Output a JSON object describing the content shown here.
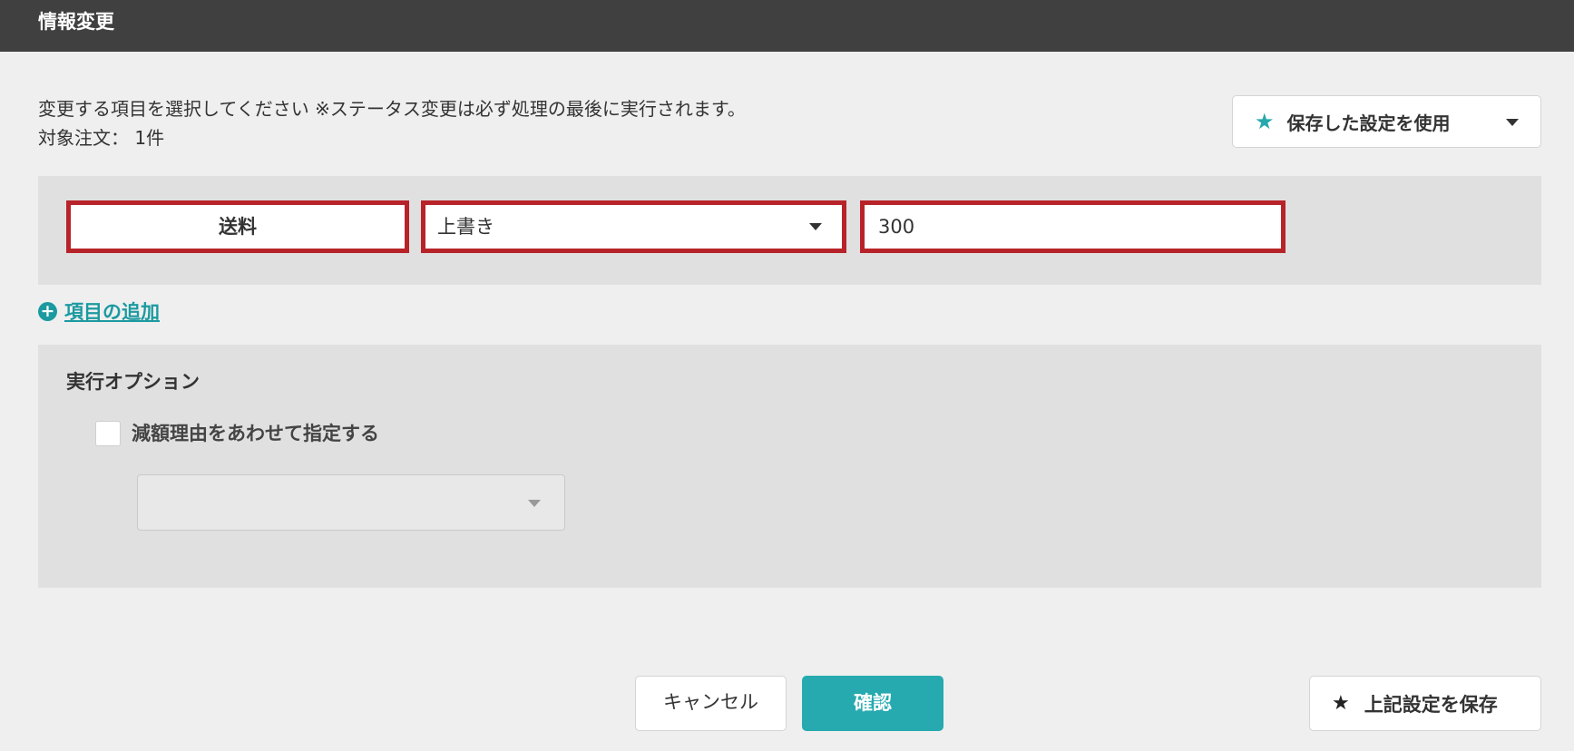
{
  "window": {
    "title": "情報変更"
  },
  "description": {
    "instruction": "変更する項目を選択してください ※ステータス変更は必ず処理の最後に実行されます。",
    "target_orders": "対象注文： 1件"
  },
  "saved_settings": {
    "label": "保存した設定を使用",
    "icon": "star-icon"
  },
  "edit_row": {
    "field_name": "送料",
    "operation": "上書き",
    "value": "300"
  },
  "add_item": {
    "label": "項目の追加",
    "icon": "plus-circle-icon"
  },
  "options": {
    "title": "実行オプション",
    "reduction_reason_label": "減額理由をあわせて指定する",
    "reduction_reason_checked": false,
    "reduction_reason_value": ""
  },
  "footer": {
    "cancel_label": "キャンセル",
    "confirm_label": "確認",
    "save_settings_label": "上記設定を保存"
  },
  "colors": {
    "accent": "#26aaaf",
    "highlight_border": "#b8232a",
    "title_bar": "#404040"
  }
}
